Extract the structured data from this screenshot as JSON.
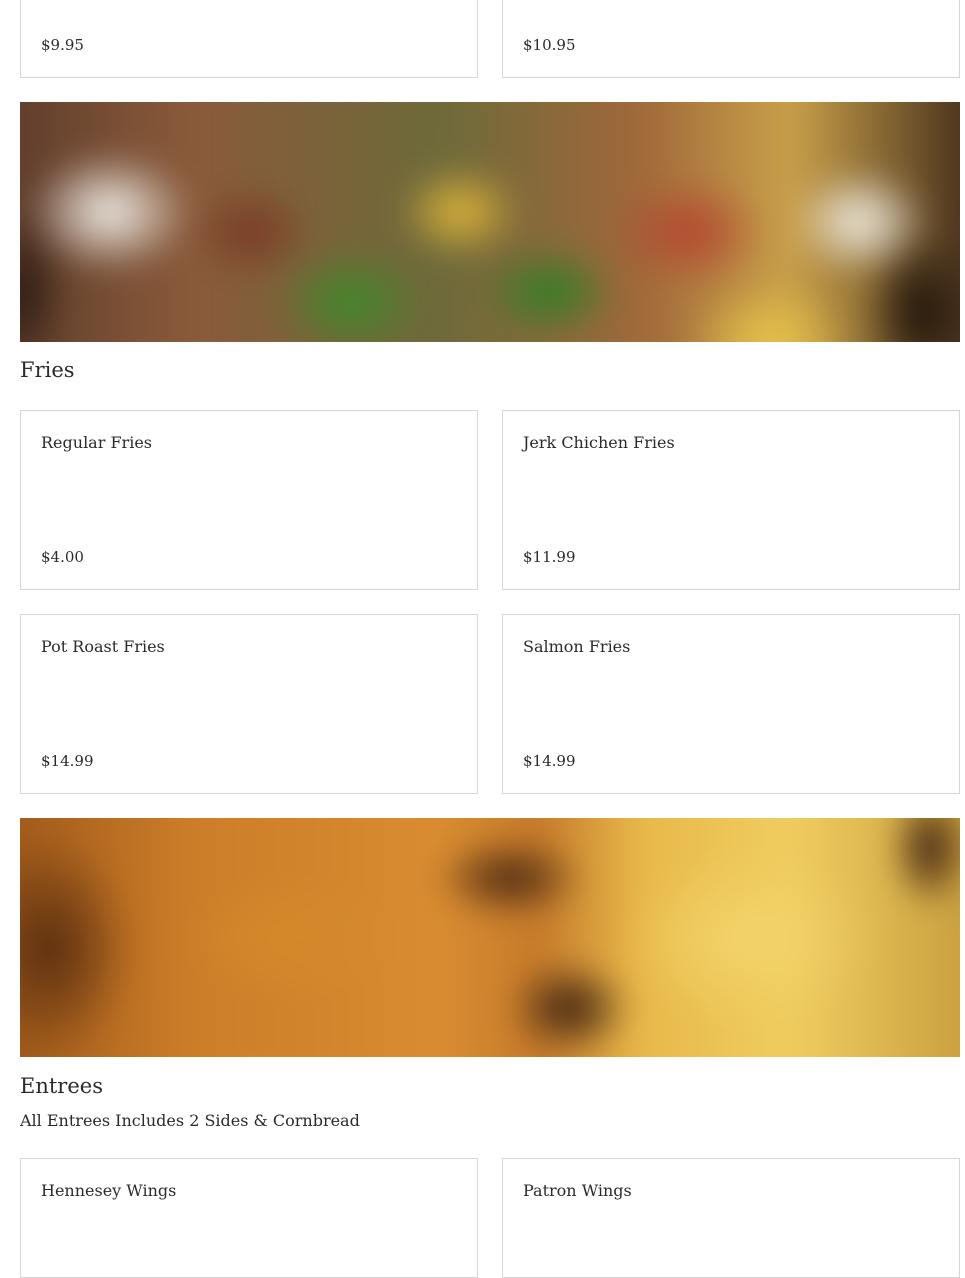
{
  "top_items": [
    {
      "price": "$9.95"
    },
    {
      "price": "$10.95"
    }
  ],
  "sections": {
    "fries": {
      "title": "Fries",
      "items": [
        {
          "name": "Regular Fries",
          "price": "$4.00"
        },
        {
          "name": "Jerk Chichen Fries",
          "price": "$11.99"
        },
        {
          "name": "Pot Roast Fries",
          "price": "$14.99"
        },
        {
          "name": "Salmon Fries",
          "price": "$14.99"
        }
      ]
    },
    "entrees": {
      "title": "Entrees",
      "subtitle": "All Entrees Includes 2 Sides & Cornbread",
      "items": [
        {
          "name": "Hennesey Wings"
        },
        {
          "name": "Patron Wings"
        }
      ]
    }
  },
  "colors": {
    "card_border": "#d6d6d6",
    "text": "#2a2a2a",
    "background": "#ffffff"
  }
}
